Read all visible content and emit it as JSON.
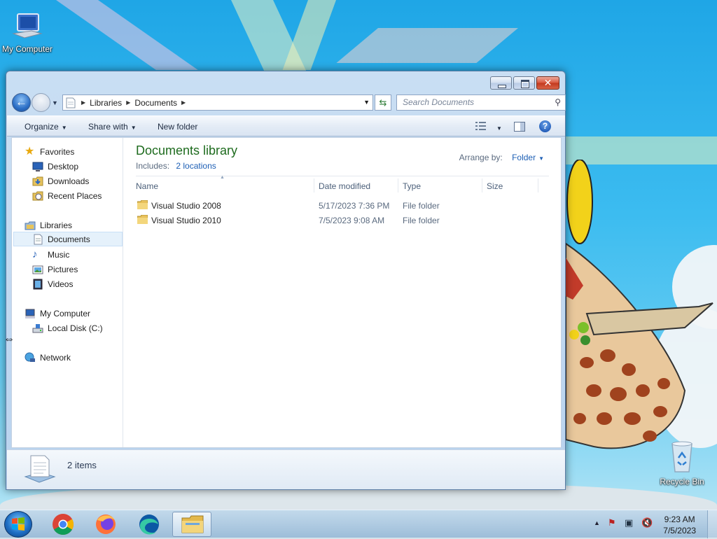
{
  "desktop": {
    "icons": [
      {
        "label": "My Computer",
        "icon": "computer-icon"
      },
      {
        "label": "Recycle Bin",
        "icon": "recycle-bin-icon"
      }
    ]
  },
  "window": {
    "address": {
      "crumbs": [
        "Libraries",
        "Documents"
      ]
    },
    "search_placeholder": "Search Documents",
    "toolbar": {
      "organize": "Organize",
      "share_with": "Share with",
      "new_folder": "New folder"
    },
    "nav": {
      "favorites": {
        "label": "Favorites",
        "items": [
          "Desktop",
          "Downloads",
          "Recent Places"
        ]
      },
      "libraries": {
        "label": "Libraries",
        "items": [
          "Documents",
          "Music",
          "Pictures",
          "Videos"
        ]
      },
      "computer": {
        "label": "My Computer",
        "items": [
          "Local Disk (C:)"
        ]
      },
      "network": {
        "label": "Network"
      }
    },
    "library": {
      "title": "Documents library",
      "includes_label": "Includes:",
      "includes_link": "2 locations",
      "arrange_label": "Arrange by:",
      "arrange_value": "Folder"
    },
    "columns": [
      "Name",
      "Date modified",
      "Type",
      "Size"
    ],
    "files": [
      {
        "name": "Visual Studio 2008",
        "date": "5/17/2023 7:36 PM",
        "type": "File folder"
      },
      {
        "name": "Visual Studio 2010",
        "date": "7/5/2023 9:08 AM",
        "type": "File folder"
      }
    ],
    "status": {
      "count": "2 items"
    }
  },
  "taskbar": {
    "apps": [
      "chrome-icon",
      "firefox-icon",
      "edge-icon",
      "file-explorer-icon"
    ],
    "clock": {
      "time": "9:23 AM",
      "date": "7/5/2023"
    }
  },
  "colors": {
    "accent": "#1e6b1e",
    "link": "#1d5fb5"
  }
}
